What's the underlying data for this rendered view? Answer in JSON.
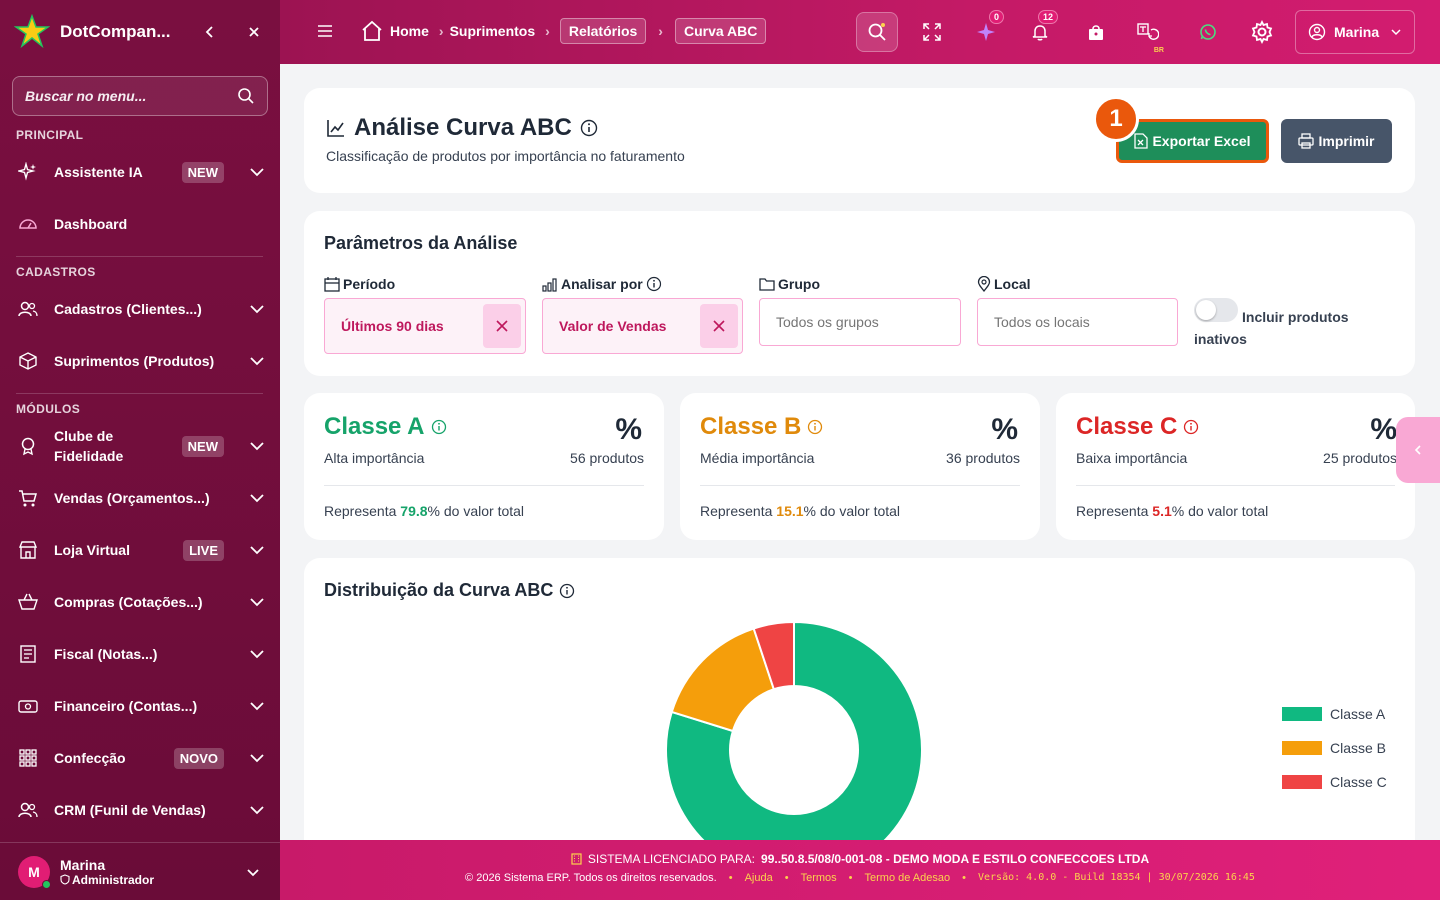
{
  "sidebar": {
    "brand": "DotCompan...",
    "search_placeholder": "Buscar no menu...",
    "sections": {
      "principal": "PRINCIPAL",
      "cadastros": "CADASTROS",
      "modulos": "MÓDULOS"
    },
    "items": [
      {
        "label": "Assistente IA",
        "badge": "NEW",
        "icon": "sparkle-icon"
      },
      {
        "label": "Dashboard",
        "badge": "",
        "icon": "gauge-icon"
      },
      {
        "label": "Cadastros (Clientes...)",
        "badge": "",
        "icon": "users-icon"
      },
      {
        "label": "Suprimentos (Produtos)",
        "badge": "",
        "icon": "box-icon"
      },
      {
        "label": "Clube de Fidelidade",
        "badge": "NEW",
        "icon": "medal-icon"
      },
      {
        "label": "Vendas (Orçamentos...)",
        "badge": "",
        "icon": "cart-icon"
      },
      {
        "label": "Loja Virtual",
        "badge": "LIVE",
        "icon": "store-icon"
      },
      {
        "label": "Compras (Cotações...)",
        "badge": "",
        "icon": "basket-icon"
      },
      {
        "label": "Fiscal (Notas...)",
        "badge": "",
        "icon": "receipt-icon"
      },
      {
        "label": "Financeiro (Contas...)",
        "badge": "",
        "icon": "money-icon"
      },
      {
        "label": "Confecção",
        "badge": "NOVO",
        "icon": "grid-icon"
      },
      {
        "label": "CRM (Funil de Vendas)",
        "badge": "",
        "icon": "users-icon"
      }
    ],
    "user": {
      "initial": "M",
      "name": "Marina",
      "role": "Administrador"
    }
  },
  "topbar": {
    "breadcrumb": {
      "home": "Home",
      "b1": "Suprimentos",
      "b2": "Relatórios",
      "b3": "Curva ABC"
    },
    "ai_count": "0",
    "notif_count": "12",
    "lang_badge": "BR",
    "user_name": "Marina"
  },
  "header": {
    "title": "Análise Curva ABC",
    "subtitle": "Classificação de produtos por importância no faturamento",
    "export_label": "Exportar Excel",
    "print_label": "Imprimir",
    "step_number": "1"
  },
  "params": {
    "title": "Parâmetros da Análise",
    "periodo_label": "Período",
    "periodo_value": "Últimos 90 dias",
    "analisar_label": "Analisar por",
    "analisar_value": "Valor de Vendas",
    "grupo_label": "Grupo",
    "grupo_placeholder": "Todos os grupos",
    "local_label": "Local",
    "local_placeholder": "Todos os locais",
    "inativos_label": "Incluir produtos",
    "inativos_label2": "inativos"
  },
  "classes": [
    {
      "title": "Classe A",
      "subtitle": "Alta importância",
      "pct_symbol": "%",
      "count": "56 produtos",
      "rep_prefix": "Representa ",
      "rep_value": "79.8",
      "rep_suffix": "% do valor total",
      "color": "#16a36a"
    },
    {
      "title": "Classe B",
      "subtitle": "Média importância",
      "pct_symbol": "%",
      "count": "36 produtos",
      "rep_prefix": "Representa ",
      "rep_value": "15.1",
      "rep_suffix": "% do valor total",
      "color": "#e08a0b"
    },
    {
      "title": "Classe C",
      "subtitle": "Baixa importância",
      "pct_symbol": "%",
      "count": "25 produtos",
      "rep_prefix": "Representa ",
      "rep_value": "5.1",
      "rep_suffix": "% do valor total",
      "color": "#dc2626"
    }
  ],
  "chart_title": "Distribuição da Curva ABC",
  "chart_data": {
    "type": "pie",
    "title": "Distribuição da Curva ABC",
    "categories": [
      "Classe A",
      "Classe B",
      "Classe C"
    ],
    "values": [
      79.8,
      15.1,
      5.1
    ],
    "colors": [
      "#10b981",
      "#f59e0b",
      "#ef4444"
    ],
    "legend": "right"
  },
  "footer": {
    "line1_prefix": "SISTEMA LICENCIADO PARA: ",
    "line1_value": "99..50.8.5/08/0-001-08 - DEMO MODA E ESTILO CONFECCOES LTDA",
    "copyright": "© 2026 Sistema ERP. Todos os direitos reservados.",
    "links": [
      "Ajuda",
      "Termos",
      "Termo de Adesao"
    ],
    "version": "Versão: 4.0.0 - Build 18354 | 30/07/2026 16:45"
  }
}
